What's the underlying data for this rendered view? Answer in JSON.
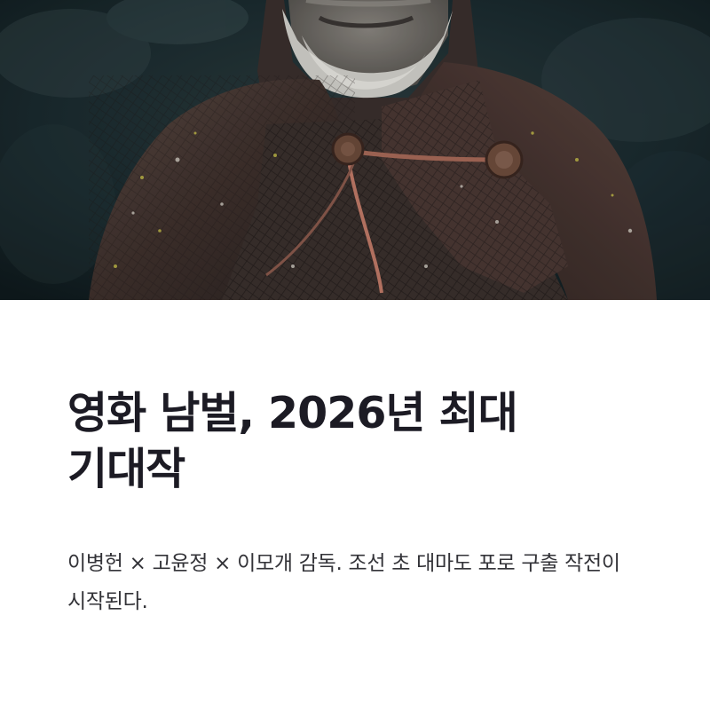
{
  "hero": {
    "image": "film-still-cloaked-bearded-man",
    "colors": {
      "background": "#1b2a2e",
      "cloak": "#4a3a34",
      "beard": "#cfcfc9",
      "clasp": "#6b4a3a",
      "cord": "#b06a5a"
    }
  },
  "article": {
    "title": "영화 남벌, 2026년 최대 기대작",
    "description": "이병헌 × 고윤정 × 이모개 감독. 조선 초 대마도 포로 구출 작전이 시작된다."
  },
  "colors": {
    "title": "#1c1b24",
    "description": "#333338",
    "page_background": "#ffffff"
  }
}
